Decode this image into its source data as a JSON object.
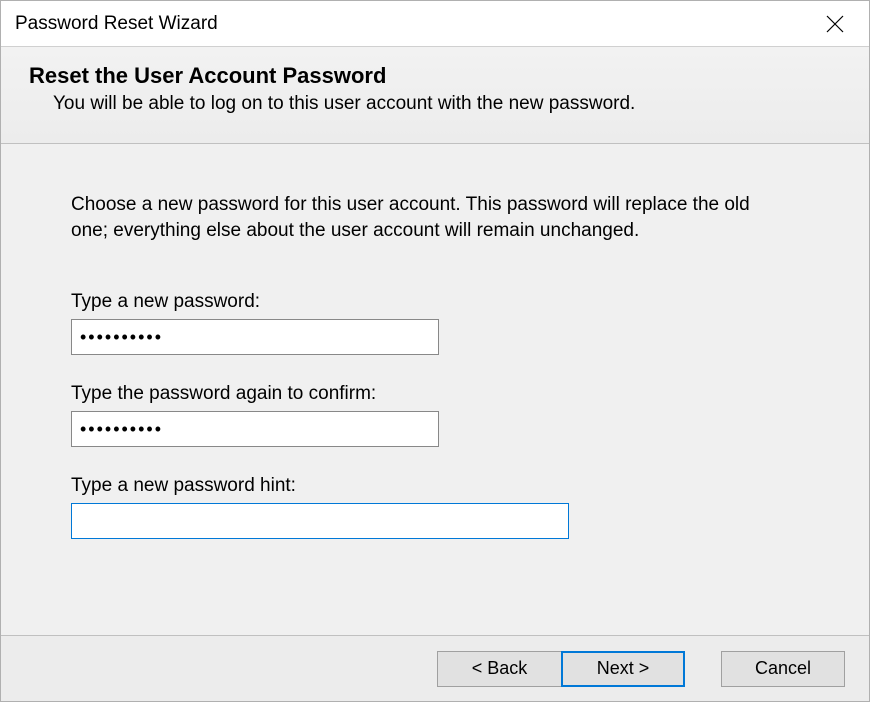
{
  "window": {
    "title": "Password Reset Wizard"
  },
  "header": {
    "title": "Reset the User Account Password",
    "subtitle": "You will be able to log on to this user account with the new password."
  },
  "content": {
    "instruction": "Choose a new password for this user account. This password will replace the old one; everything else about the user account will remain unchanged.",
    "new_password_label": "Type a new password:",
    "new_password_value": "••••••••••",
    "confirm_password_label": "Type the password again to confirm:",
    "confirm_password_value": "••••••••••",
    "hint_label": "Type a new password hint:",
    "hint_value": ""
  },
  "buttons": {
    "back": "< Back",
    "next": "Next >",
    "cancel": "Cancel"
  }
}
